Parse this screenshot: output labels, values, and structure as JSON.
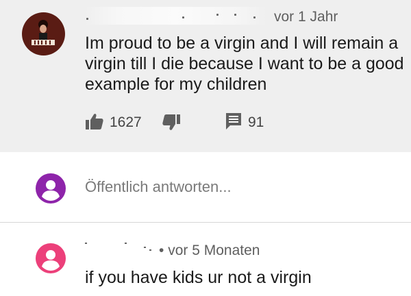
{
  "comment": {
    "timestamp": "vor 1 Jahr",
    "text": "Im proud to be a virgin and I will remain a virgin till I die because I want to be a good example for my children",
    "likes": "1627",
    "replies": "91"
  },
  "reply_box": {
    "placeholder": "Öffentlich antworten..."
  },
  "reply": {
    "timestamp": "vor 5 Monaten",
    "separator": "•",
    "text": "if you have kids ur not a virgin"
  },
  "colors": {
    "comment_background": "#efefef",
    "reply_box_avatar": "#8e24aa",
    "reply_avatar": "#ec407a",
    "icon_gray": "#5f5f5f"
  },
  "icons": {
    "like": "thumbs-up-icon",
    "dislike": "thumbs-down-icon",
    "replies": "comment-icon",
    "generic_avatar": "person-icon"
  }
}
